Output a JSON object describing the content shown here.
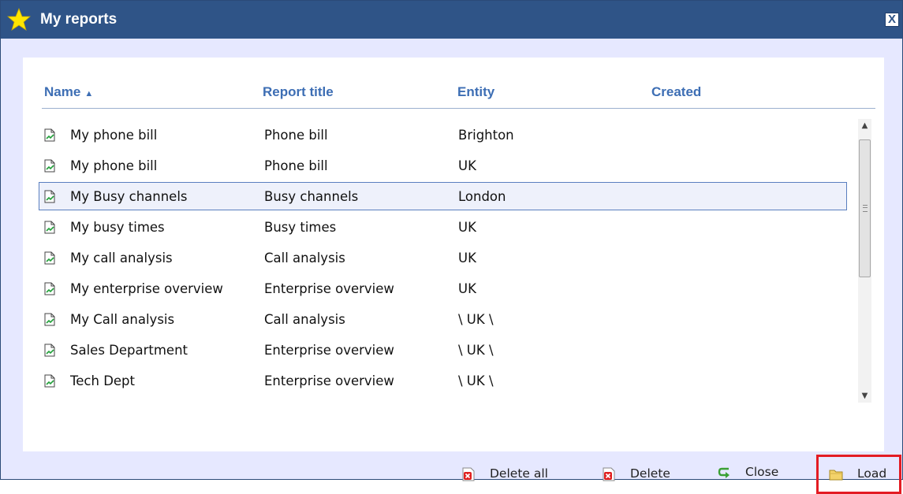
{
  "window": {
    "title": "My reports",
    "close_label": "X"
  },
  "table": {
    "columns": [
      {
        "label": "Name",
        "sort": "ascending",
        "sort_glyph": "▲"
      },
      {
        "label": "Report title"
      },
      {
        "label": "Entity"
      },
      {
        "label": "Created"
      }
    ],
    "rows": [
      {
        "name": "My phone bill",
        "report_title": "Phone bill",
        "entity": "Brighton",
        "selected": false
      },
      {
        "name": "My phone bill",
        "report_title": "Phone bill",
        "entity": "UK",
        "selected": false
      },
      {
        "name": "My Busy channels",
        "report_title": "Busy channels",
        "entity": "London",
        "selected": true
      },
      {
        "name": "My busy times",
        "report_title": "Busy times",
        "entity": "UK",
        "selected": false
      },
      {
        "name": "My call analysis",
        "report_title": "Call analysis",
        "entity": "UK",
        "selected": false
      },
      {
        "name": "My enterprise overview",
        "report_title": "Enterprise overview",
        "entity": "UK",
        "selected": false
      },
      {
        "name": "My Call analysis",
        "report_title": "Call analysis",
        "entity": "\\ UK \\",
        "selected": false
      },
      {
        "name": "Sales Department",
        "report_title": "Enterprise overview",
        "entity": "\\ UK \\",
        "selected": false
      },
      {
        "name": "Tech Dept",
        "report_title": "Enterprise overview",
        "entity": "\\ UK \\",
        "selected": false
      }
    ]
  },
  "footer": {
    "buttons": [
      {
        "label": "Delete all",
        "icon": "delete-all-icon"
      },
      {
        "label": "Delete",
        "icon": "delete-icon"
      },
      {
        "label": "Close",
        "icon": "close-arrow-icon"
      },
      {
        "label": "Load",
        "icon": "folder-icon",
        "highlighted": true
      }
    ]
  },
  "colors": {
    "titlebar": "#2f5487",
    "header_text": "#3d6eb4",
    "dialog_bg": "#e6e8ff",
    "highlight": "#e31c23"
  }
}
